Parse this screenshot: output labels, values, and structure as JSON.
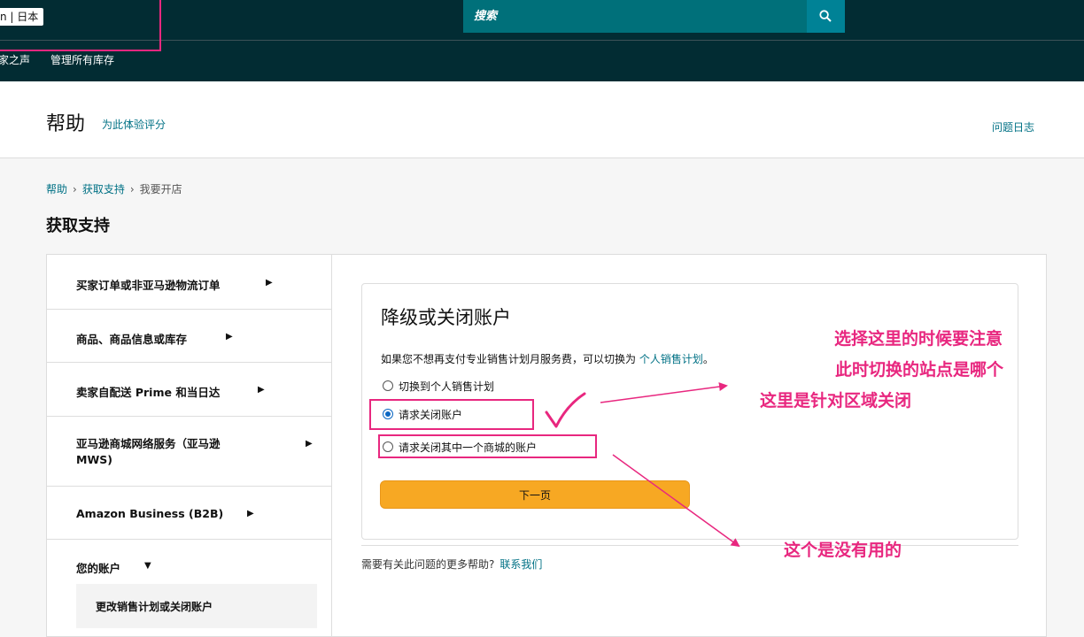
{
  "topbar": {
    "marketplace_label": "n | 日本",
    "search_placeholder": "搜索",
    "search_icon": "search-icon"
  },
  "nav": {
    "items": [
      "家之声",
      "管理所有库存"
    ]
  },
  "help_header": {
    "title": "帮助",
    "rate_link": "为此体验评分",
    "issue_log": "问题日志"
  },
  "breadcrumb": {
    "items": [
      "帮助",
      "获取支持",
      "我要开店"
    ],
    "separator": "›"
  },
  "section_title": "获取支持",
  "sidebar": {
    "items": [
      {
        "label": "买家订单或非亚马逊物流订单",
        "arrow": "▶"
      },
      {
        "label": "商品、商品信息或库存",
        "arrow": "▶"
      },
      {
        "label": "卖家自配送 Prime 和当日达",
        "arrow": "▶"
      },
      {
        "label": "亚马逊商城网络服务（亚马逊\nMWS)",
        "arrow": "▶"
      },
      {
        "label": "Amazon Business (B2B)",
        "arrow": "▶"
      },
      {
        "label": "您的账户",
        "arrow": "▼"
      }
    ],
    "sub_item": "更改销售计划或关闭账户"
  },
  "card": {
    "title": "降级或关闭账户",
    "description": "如果您不想再支付专业销售计划月服务费，可以切换为",
    "description_link": "个人销售计划",
    "description_end": "。",
    "options": [
      {
        "label": "切换到个人销售计划",
        "checked": false
      },
      {
        "label": "请求关闭账户",
        "checked": true
      },
      {
        "label": "请求关闭其中一个商城的账户",
        "checked": false
      }
    ],
    "next_button": "下一页"
  },
  "more_help": {
    "text": "需要有关此问题的更多帮助?",
    "link": "联系我们"
  },
  "annotations": {
    "note1_line1": "选择这里的时候要注意",
    "note1_line2": "此时切换的站点是哪个",
    "note2": "这里是针对区域关闭",
    "note3": "这个是没有用的",
    "color": "#e8277f"
  },
  "colors": {
    "topbar": "#022c33",
    "search": "#00707a",
    "link": "#007185",
    "button": "#f7a823"
  }
}
